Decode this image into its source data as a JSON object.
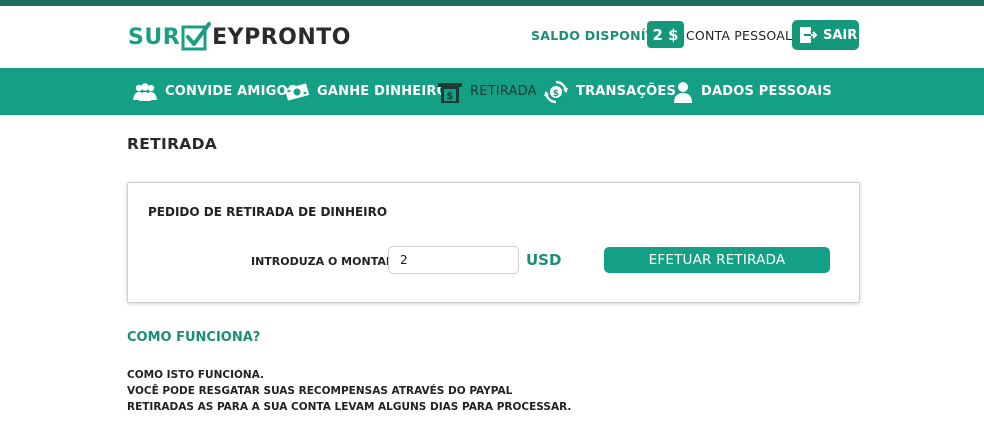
{
  "brand": {
    "logo_part1": "SUR",
    "logo_part2": "EYPRONTO",
    "accent": "#14a084",
    "dark": "#1f6f5c"
  },
  "header": {
    "balance_label": "SALDO DISPONÍVEL",
    "balance_value": "2 $",
    "account_label": "CONTA PESSOAL",
    "logout_label": "SAIR"
  },
  "nav": {
    "items": [
      {
        "label": "CONVIDE AMIGOS",
        "icon": "users-icon"
      },
      {
        "label": "GANHE DINHEIRO",
        "icon": "money-icon"
      },
      {
        "label": "RETIRADA",
        "icon": "atm-icon",
        "active": true
      },
      {
        "label": "TRANSAÇÕES",
        "icon": "transactions-icon"
      },
      {
        "label": "DADOS PESSOAIS",
        "icon": "user-icon"
      }
    ]
  },
  "page": {
    "title": "RETIRADA"
  },
  "withdraw": {
    "panel_title": "PEDIDO DE RETIRADA DE DINHEIRO",
    "amount_label": "INTRODUZA O MONTANTE:",
    "amount_value": "2",
    "currency": "USD",
    "button_label": "EFETUAR RETIRADA"
  },
  "how": {
    "title": "COMO FUNCIONA?",
    "lines": [
      "COMO ISTO FUNCIONA.",
      "VOCÊ PODE RESGATAR SUAS RECOMPENSAS ATRAVÉS DO PAYPAL",
      "RETIRADAS AS PARA A SUA CONTA LEVAM ALGUNS DIAS PARA PROCESSAR."
    ]
  }
}
